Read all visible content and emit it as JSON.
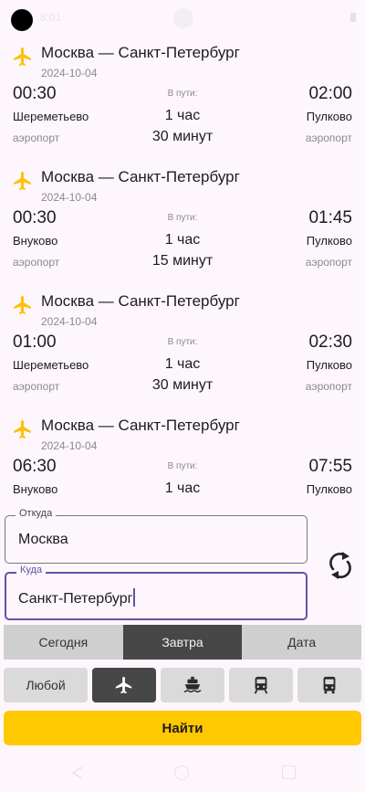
{
  "status_bar": {
    "time": "8:01"
  },
  "flights": [
    {
      "route": "Москва — Санкт-Петербург",
      "date": "2024-10-04",
      "departure_time": "00:30",
      "arrival_time": "02:00",
      "in_path_label": "В пути:",
      "departure_airport": "Шереметьево",
      "arrival_airport": "Пулково",
      "duration_hours": "1 час",
      "departure_type": "аэропорт",
      "arrival_type": "аэропорт",
      "duration_minutes": "30 минут"
    },
    {
      "route": "Москва — Санкт-Петербург",
      "date": "2024-10-04",
      "departure_time": "00:30",
      "arrival_time": "01:45",
      "in_path_label": "В пути:",
      "departure_airport": "Внуково",
      "arrival_airport": "Пулково",
      "duration_hours": "1 час",
      "departure_type": "аэропорт",
      "arrival_type": "аэропорт",
      "duration_minutes": "15 минут"
    },
    {
      "route": "Москва — Санкт-Петербург",
      "date": "2024-10-04",
      "departure_time": "01:00",
      "arrival_time": "02:30",
      "in_path_label": "В пути:",
      "departure_airport": "Шереметьево",
      "arrival_airport": "Пулково",
      "duration_hours": "1 час",
      "departure_type": "аэропорт",
      "arrival_type": "аэропорт",
      "duration_minutes": "30 минут"
    },
    {
      "route": "Москва — Санкт-Петербург",
      "date": "2024-10-04",
      "departure_time": "06:30",
      "arrival_time": "07:55",
      "in_path_label": "В пути:",
      "departure_airport": "Внуково",
      "arrival_airport": "Пулково",
      "duration_hours": "1 час"
    }
  ],
  "form": {
    "from_label": "Откуда",
    "from_value": "Москва",
    "to_label": "Куда",
    "to_value": "Санкт-Петербург"
  },
  "date_tabs": {
    "today": "Сегодня",
    "tomorrow": "Завтра",
    "date": "Дата",
    "selected": "Завтра"
  },
  "transport_modes": {
    "any": "Любой",
    "selected": "plane-icon",
    "icons": [
      "plane-icon",
      "ship-icon",
      "train-icon",
      "bus-icon"
    ]
  },
  "search_button": "Найти",
  "colors": {
    "accent": "#ffc800",
    "focus": "#6750a4",
    "selected_tab": "#474747"
  }
}
